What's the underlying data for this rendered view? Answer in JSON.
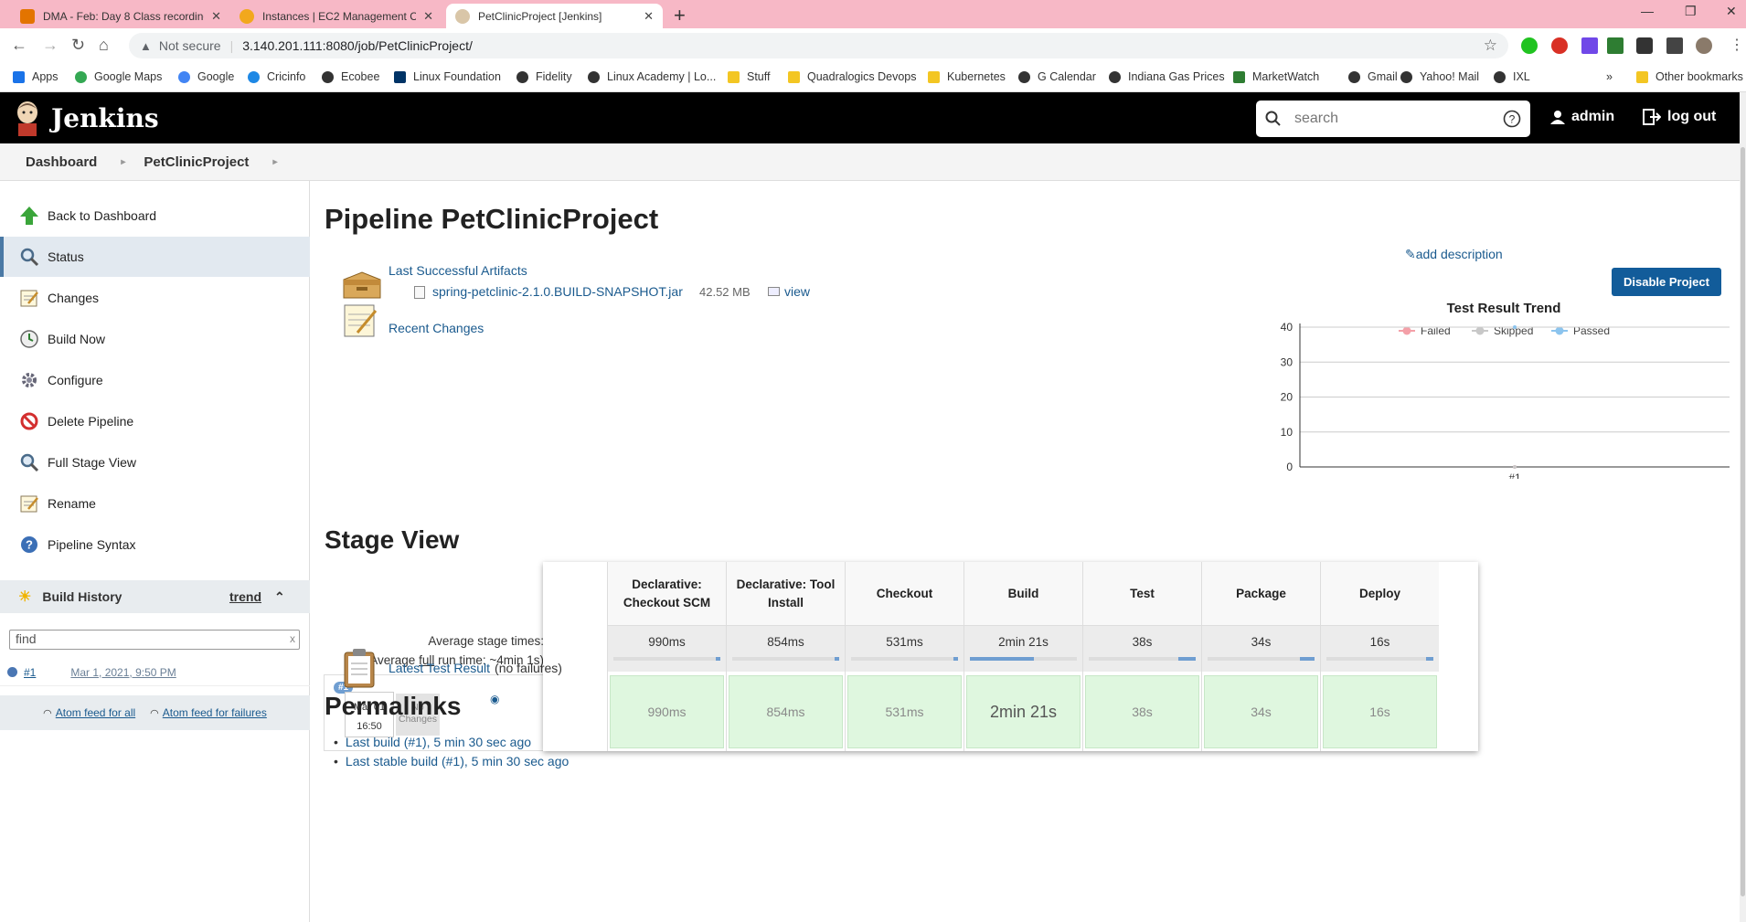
{
  "browser": {
    "tabs": [
      {
        "title": "DMA - Feb: Day 8 Class recording"
      },
      {
        "title": "Instances | EC2 Management Con"
      },
      {
        "title": "PetClinicProject [Jenkins]"
      }
    ],
    "not_secure": "Not secure",
    "url": "3.140.201.111:8080/job/PetClinicProject/",
    "bookmarks": [
      "Apps",
      "Google Maps",
      "Google",
      "Cricinfo",
      "Ecobee",
      "Linux Foundation",
      "Fidelity",
      "Linux Academy | Lo...",
      "Stuff",
      "Quadralogics Devops",
      "Kubernetes",
      "G Calendar",
      "Indiana Gas Prices",
      "MarketWatch",
      "Gmail",
      "Yahoo! Mail",
      "IXL"
    ],
    "other_bookmarks": "Other bookmarks"
  },
  "header": {
    "brand": "Jenkins",
    "search_placeholder": "search",
    "user": "admin",
    "logout": "log out"
  },
  "breadcrumb": [
    "Dashboard",
    "PetClinicProject"
  ],
  "sidebar": {
    "tasks": [
      {
        "label": "Back to Dashboard",
        "icon": "up-arrow-icon"
      },
      {
        "label": "Status",
        "icon": "search-icon"
      },
      {
        "label": "Changes",
        "icon": "notepad-icon"
      },
      {
        "label": "Build Now",
        "icon": "clock-icon"
      },
      {
        "label": "Configure",
        "icon": "gear-icon"
      },
      {
        "label": "Delete Pipeline",
        "icon": "no-entry-icon"
      },
      {
        "label": "Full Stage View",
        "icon": "search-icon"
      },
      {
        "label": "Rename",
        "icon": "notepad-icon"
      },
      {
        "label": "Pipeline Syntax",
        "icon": "help-icon"
      }
    ],
    "build_history": {
      "title": "Build History",
      "trend": "trend",
      "find_placeholder": "find",
      "clear": "x",
      "builds": [
        {
          "number": "#1",
          "date": "Mar 1, 2021, 9:50 PM"
        }
      ],
      "atom_all": "Atom feed for all",
      "atom_failures": "Atom feed for failures"
    }
  },
  "main": {
    "title": "Pipeline PetClinicProject",
    "add_description": "add description",
    "disable_button": "Disable Project",
    "last_successful_artifacts": "Last Successful Artifacts",
    "artifact": {
      "name": "spring-petclinic-2.1.0.BUILD-SNAPSHOT.jar",
      "size": "42.52 MB",
      "view": "view"
    },
    "recent_changes": "Recent Changes",
    "stage_view_title": "Stage View",
    "avg_stage_times": "Average stage times:",
    "avg_full_prefix": "(Average ",
    "avg_full_link": "full",
    "avg_full_suffix": " run time: ~4min 1s)",
    "build": {
      "badge": "#1",
      "month_day": "Mar 01",
      "time": "16:50",
      "no_changes": "No Changes"
    },
    "stages": [
      {
        "name": "Declarative: Checkout SCM",
        "avg": "990ms",
        "run": "990ms",
        "progress": 0.0
      },
      {
        "name": "Declarative: Tool Install",
        "avg": "854ms",
        "run": "854ms",
        "progress": 0.0
      },
      {
        "name": "Checkout",
        "avg": "531ms",
        "run": "531ms",
        "progress": 0.0
      },
      {
        "name": "Build",
        "avg": "2min 21s",
        "run": "2min 21s",
        "progress": 0.6
      },
      {
        "name": "Test",
        "avg": "38s",
        "run": "38s",
        "progress": 0.16
      },
      {
        "name": "Package",
        "avg": "34s",
        "run": "34s",
        "progress": 0.14
      },
      {
        "name": "Deploy",
        "avg": "16s",
        "run": "16s",
        "progress": 0.07
      }
    ],
    "latest_test_result": "Latest Test Result",
    "no_failures": "(no failures)",
    "permalinks_title": "Permalinks",
    "permalinks": [
      "Last build (#1), 5 min 30 sec ago",
      "Last stable build (#1), 5 min 30 sec ago"
    ]
  },
  "chart_data": {
    "type": "line",
    "title": "Test Result Trend",
    "categories": [
      "#1"
    ],
    "series": [
      {
        "name": "Failed",
        "values": [
          0
        ],
        "color": "#f4a0a8"
      },
      {
        "name": "Skipped",
        "values": [
          0
        ],
        "color": "#c8c8c8"
      },
      {
        "name": "Passed",
        "values": [
          40
        ],
        "color": "#8cc4ee"
      }
    ],
    "ylim": [
      0,
      40
    ],
    "yticks": [
      0,
      10,
      20,
      30,
      40
    ],
    "legend": "top",
    "grid": true
  }
}
